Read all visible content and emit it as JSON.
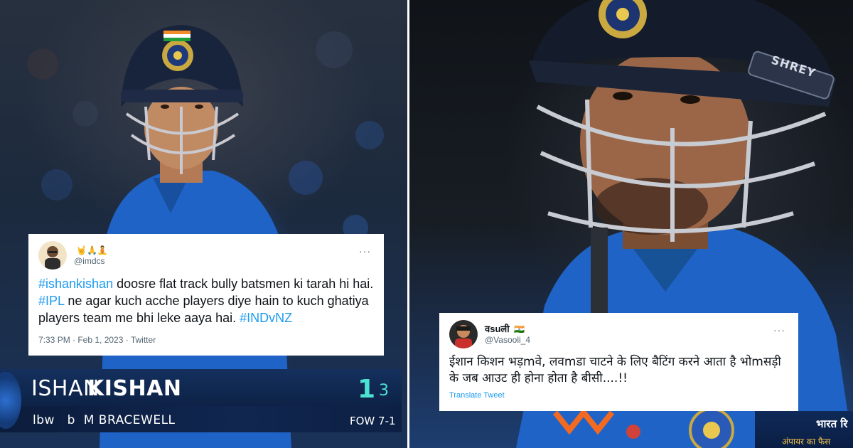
{
  "tweets": [
    {
      "name_emoji": "🤘🙏🧘",
      "handle": "@imdcs",
      "more": "···",
      "text_parts": [
        {
          "text": "#ishankishan",
          "tag": true
        },
        {
          "text": "  doosre flat track bully batsmen ki tarah hi hai. ",
          "tag": false
        },
        {
          "text": "#IPL",
          "tag": true
        },
        {
          "text": " ne agar kuch acche players diye hain to kuch ghatiya players team me bhi leke aaya hai. ",
          "tag": false
        },
        {
          "text": "#INDvNZ",
          "tag": true
        }
      ],
      "footer": "7:33 PM · Feb 1, 2023 · Twitter"
    },
    {
      "name": "वsuली",
      "name_emoji": "🇮🇳",
      "handle": "@Vasooli_4",
      "more": "···",
      "text": "ईशान किशन भड़mवे, लवmडा चाटने के लिए बैटिंग करने आता है भोmसड़ी के जब आउट ही होना होता है बीसी....!!",
      "translate": "Translate Tweet"
    }
  ],
  "helmet_brand": "SHREY",
  "scorebar": {
    "first_name": "ISHAN",
    "last_name": "KISHAN",
    "runs": "1",
    "balls": "3",
    "dismissal": "lbw   b  M BRACEWELL",
    "fow": "FOW 7-1"
  },
  "hindi_strip": {
    "line1": "भारत रि",
    "line2": "अंपायर का फैस"
  },
  "colors": {
    "hashtag": "#1d9bf0",
    "runs": "#4be2d4",
    "scorebar_bg": "#10264f",
    "team_blue": "#1f63c7"
  }
}
